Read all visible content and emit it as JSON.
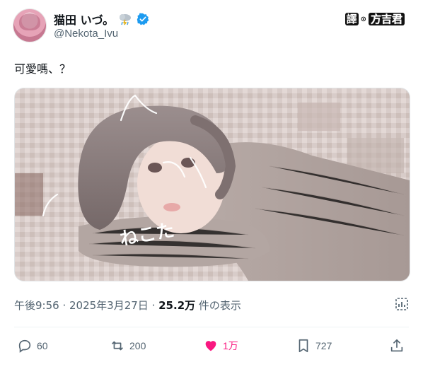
{
  "author": {
    "display_name": "猫田 いづ。",
    "handle": "@Nekota_Ivu",
    "weather_icon": "rain-cloud-icon",
    "verified_icon": "verified-badge-icon"
  },
  "translator_badge": {
    "char": "譯",
    "sep": "⊙",
    "who": "方吉君"
  },
  "tweet": {
    "text": "可愛嗎、？",
    "media_handwriting": "ねこた"
  },
  "meta": {
    "time": "午後9:56",
    "dot1": " · ",
    "date": "2025年3月27日",
    "dot2": " · ",
    "views": "25.2万",
    "views_label": " 件の表示"
  },
  "actions": {
    "reply": {
      "icon": "reply-icon",
      "count": "60"
    },
    "retweet": {
      "icon": "retweet-icon",
      "count": "200"
    },
    "like": {
      "icon": "heart-filled-icon",
      "count": "1万",
      "color": "#f91880"
    },
    "bookmark": {
      "icon": "bookmark-icon",
      "count": "727"
    },
    "share": {
      "icon": "share-icon"
    }
  },
  "colors": {
    "text_primary": "#0f1419",
    "text_secondary": "#536471",
    "verified": "#1d9bf0",
    "like": "#f91880"
  }
}
